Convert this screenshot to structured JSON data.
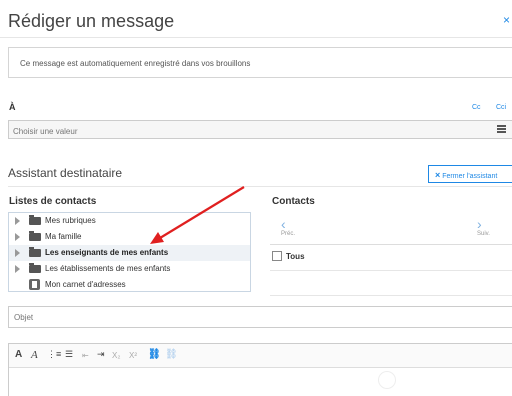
{
  "dialog": {
    "title": "Rédiger un message",
    "close_icon": "×"
  },
  "notice": {
    "text": "Ce message est automatiquement enregistré dans vos brouillons"
  },
  "recipients": {
    "label": "À",
    "cc_label": "Cc",
    "cci_label": "Cci",
    "placeholder": "Choisir une valeur"
  },
  "assistant": {
    "title": "Assistant destinataire",
    "close_label": "Fermer l'assistant",
    "close_icon": "×",
    "lists_title": "Listes de contacts",
    "lists": [
      {
        "label": "Mes rubriques",
        "icon": "folder-icon",
        "selected": false
      },
      {
        "label": "Ma famille",
        "icon": "folder-icon",
        "selected": false
      },
      {
        "label": "Les enseignants de mes enfants",
        "icon": "folder-icon",
        "selected": true
      },
      {
        "label": "Les établissements de mes enfants",
        "icon": "folder-icon",
        "selected": false
      },
      {
        "label": "Mon carnet d'adresses",
        "icon": "address-book-icon",
        "selected": false
      }
    ],
    "contacts_title": "Contacts",
    "prev_icon": "‹",
    "prev_label": "Préc.",
    "next_icon": "›",
    "next_label": "Suiv.",
    "all_label": "Tous"
  },
  "subject": {
    "placeholder": "Objet"
  },
  "toolbar": {
    "bold": "A",
    "italic": "A",
    "ordered_list": "⋮≡",
    "unordered_list": "☰",
    "outdent": "⇤",
    "indent": "⇥",
    "subscript": "X₂",
    "superscript": "X²",
    "link": "⛓",
    "unlink": "⛓"
  },
  "colors": {
    "accent": "#1e88e5",
    "arrow": "#e02020"
  }
}
